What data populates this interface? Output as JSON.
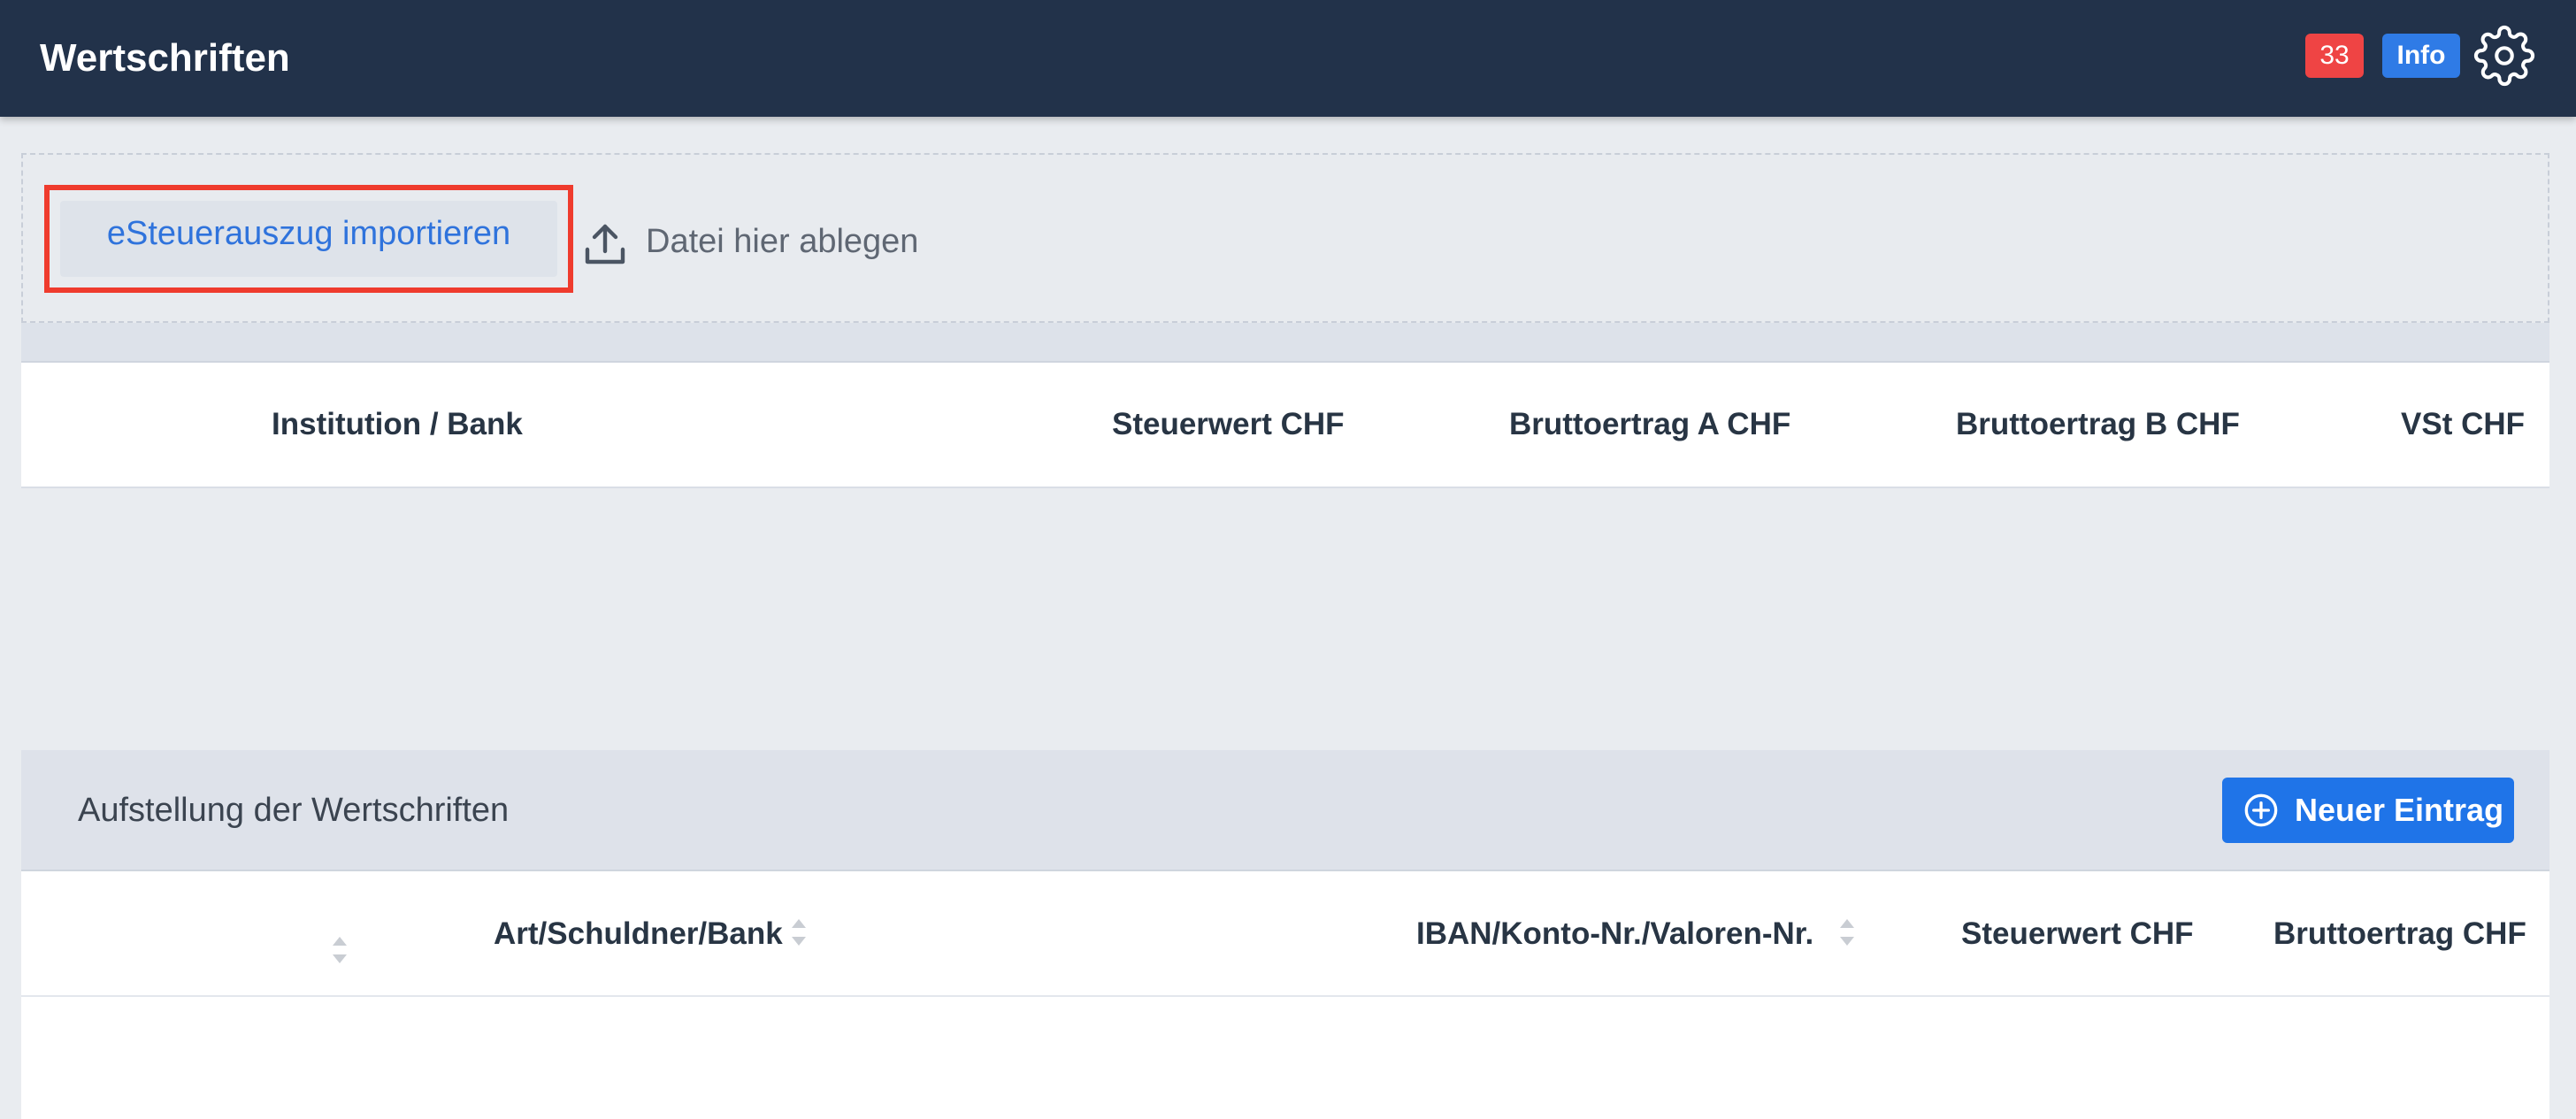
{
  "header": {
    "title": "Wertschriften",
    "notification_count": "33",
    "info_label": "Info",
    "settings_icon": "gear-icon"
  },
  "import": {
    "button_label": "eSteuerauszug importieren",
    "drop_label": "Datei hier ablegen",
    "upload_icon": "upload-icon"
  },
  "summary_table": {
    "columns": [
      "Institution / Bank",
      "Steuerwert CHF",
      "Bruttoertrag A CHF",
      "Bruttoertrag B CHF",
      "VSt CHF"
    ]
  },
  "securities": {
    "title": "Aufstellung der Wertschriften",
    "new_entry_label": "Neuer Eintrag",
    "columns": [
      "Art/Schuldner/Bank",
      "IBAN/Konto-Nr./Valoren-Nr.",
      "Steuerwert CHF",
      "Bruttoertrag CHF"
    ]
  },
  "colors": {
    "header_bg": "#22324a",
    "badge_red": "#ef4444",
    "badge_blue": "#2f7be6",
    "primary_button": "#1f74e8",
    "highlight_border": "#ef3b2d",
    "link_blue": "#2f73dc"
  }
}
